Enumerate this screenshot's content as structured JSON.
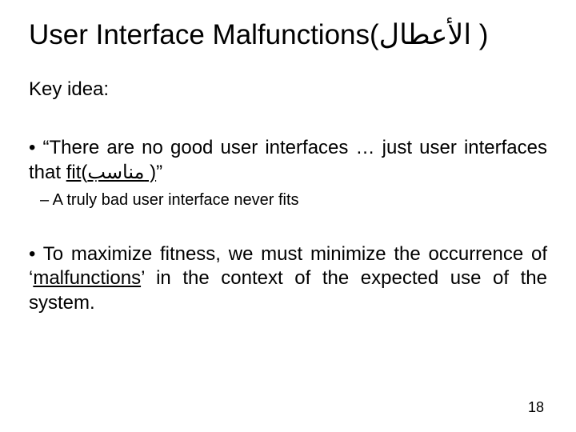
{
  "title_prefix": "User Interface Malfunctions(",
  "title_ar": "الأعطال",
  "title_suffix": " )",
  "key_idea": "Key idea:",
  "b1_a": "• “There are no good user interfaces … just user interfaces that ",
  "b1_fit": "fit",
  "b1_paren_open": "(",
  "b1_ar": "مناسب",
  "b1_paren_close": " )",
  "b1_end": "”",
  "sub1": "– A truly bad user interface never fits",
  "b2_a": "• To maximize fitness, we must minimize the occurrence of ‘",
  "b2_mal": "malfunctions",
  "b2_b": "’ in the context of the expected use of the system.",
  "page": "18"
}
